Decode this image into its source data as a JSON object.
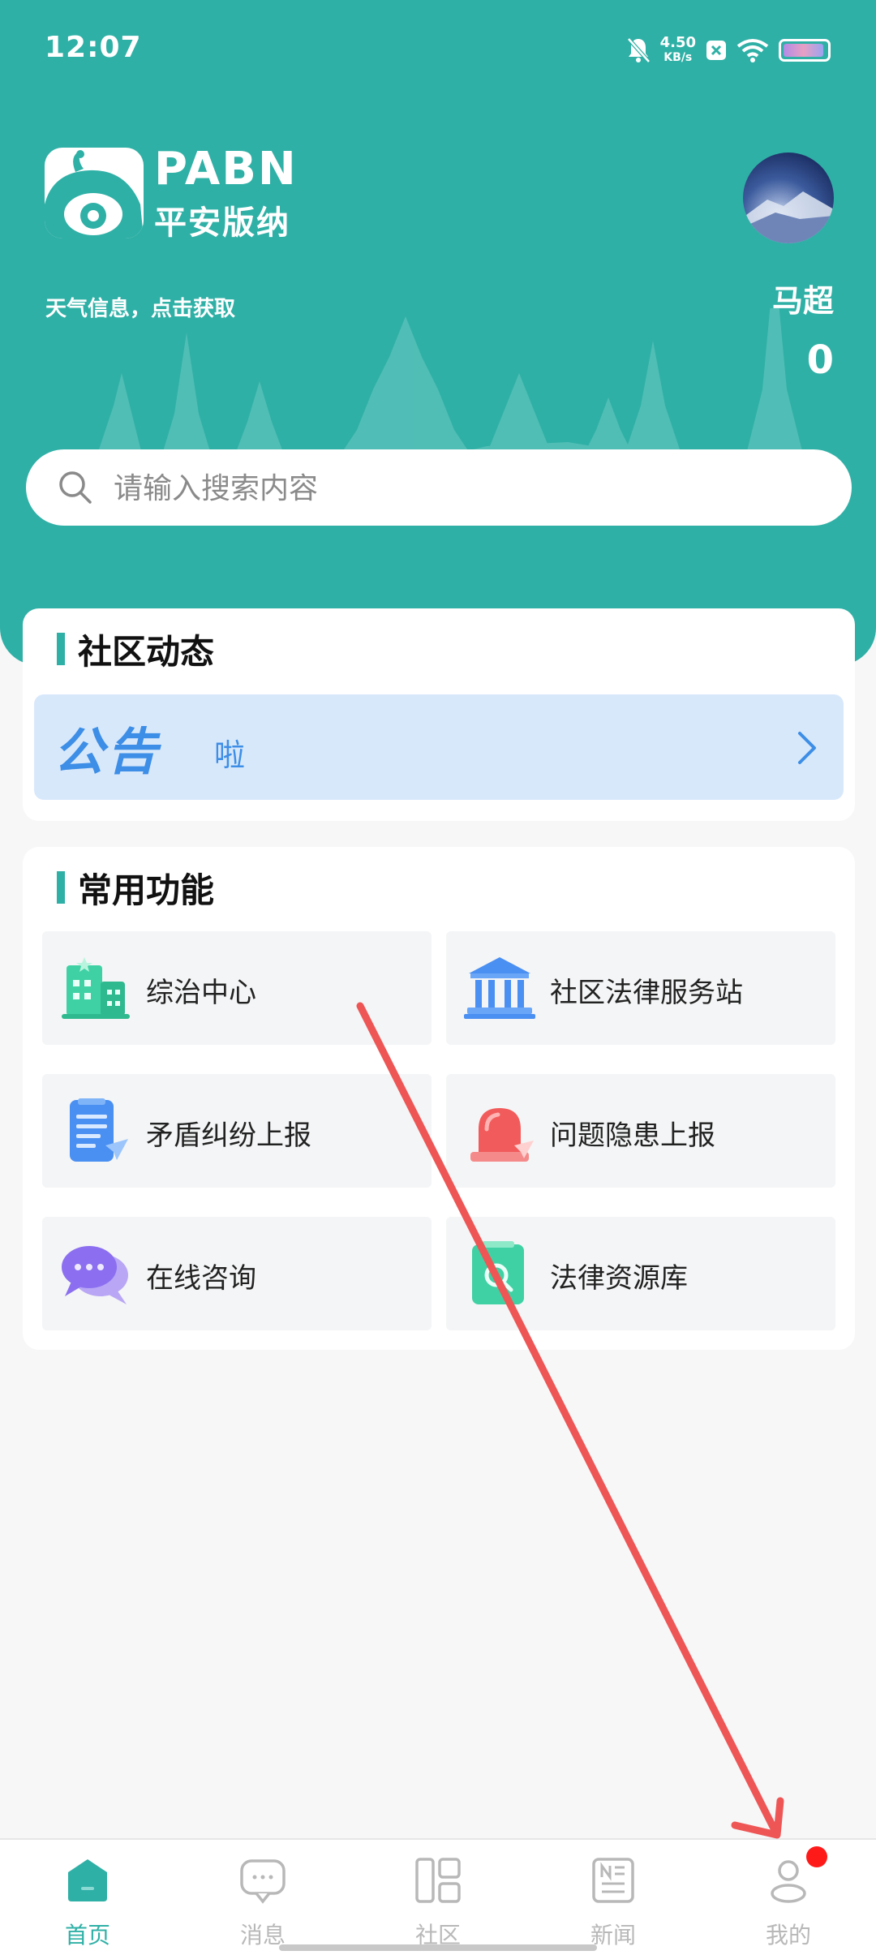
{
  "status_bar": {
    "time": "12:07",
    "net_speed": "4.50",
    "net_unit": "KB/s"
  },
  "header": {
    "logo_en": "PABN",
    "logo_cn": "平安版纳",
    "weather": "天气信息，点击获取",
    "username": "马超",
    "points": "0"
  },
  "search": {
    "placeholder": "请输入搜索内容"
  },
  "community": {
    "title": "社区动态",
    "notice_label": "公告",
    "notice_text": "啦"
  },
  "functions": {
    "title": "常用功能",
    "items": [
      {
        "label": "综治中心",
        "icon": "building-icon"
      },
      {
        "label": "社区法律服务站",
        "icon": "courthouse-icon"
      },
      {
        "label": "矛盾纠纷上报",
        "icon": "report-document-icon"
      },
      {
        "label": "问题隐患上报",
        "icon": "alarm-light-icon"
      },
      {
        "label": "在线咨询",
        "icon": "chat-bubbles-icon"
      },
      {
        "label": "法律资源库",
        "icon": "book-search-icon"
      }
    ]
  },
  "tabbar": {
    "tabs": [
      {
        "label": "首页",
        "icon": "home-icon",
        "active": true
      },
      {
        "label": "消息",
        "icon": "message-icon",
        "active": false
      },
      {
        "label": "社区",
        "icon": "community-grid-icon",
        "active": false
      },
      {
        "label": "新闻",
        "icon": "news-icon",
        "active": false
      },
      {
        "label": "我的",
        "icon": "profile-icon",
        "active": false
      }
    ]
  },
  "colors": {
    "primary": "#2fb0a6",
    "notice_bg": "#d8e8fb",
    "notice_text": "#3d8ee6",
    "badge": "#ff1a1a",
    "annotation_arrow": "#ee5656"
  }
}
